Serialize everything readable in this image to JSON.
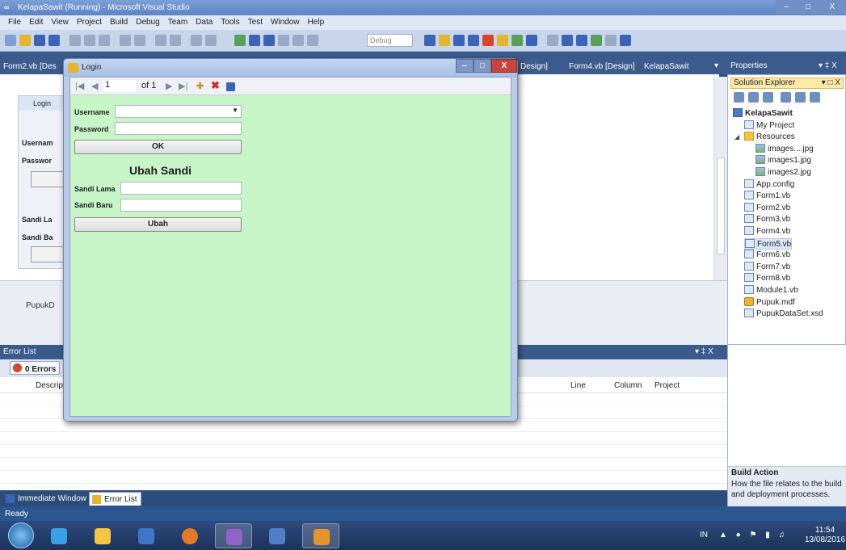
{
  "window": {
    "title": "KelapaSawit (Running) - Microsoft Visual Studio",
    "minimize": "‒",
    "restore": "□",
    "close": "X"
  },
  "menu": [
    "File",
    "Edit",
    "View",
    "Project",
    "Build",
    "Debug",
    "Team",
    "Data",
    "Tools",
    "Test",
    "Window",
    "Help"
  ],
  "toolbar": {
    "config": "Debug"
  },
  "doc_tabs": [
    {
      "label": "Form2.vb [Des"
    },
    {
      "label": "Design]"
    },
    {
      "label": "Form4.vb [Design]"
    },
    {
      "label": "KelapaSawit"
    }
  ],
  "background_form": {
    "title": "Login",
    "username": "Usernam",
    "password": "Passwor",
    "sandi_lama": "Sandi La",
    "sandi_baru": "Sandi Ba",
    "tray_item": "PupukD"
  },
  "error_list": {
    "title": "Error List",
    "errors_button": "0 Errors",
    "columns": [
      "Descrip",
      "Line",
      "Column",
      "Project"
    ]
  },
  "bottom_tabs": [
    {
      "label": "Immediate Window"
    },
    {
      "label": "Error List"
    }
  ],
  "status": "Ready",
  "properties": {
    "title": "Properties",
    "pin": "▾   1 X"
  },
  "solution_explorer": {
    "title": "Solution Explorer",
    "items": [
      {
        "label": "KelapaSawit",
        "indent": 0,
        "type": "proj",
        "bold": true
      },
      {
        "label": "My Project",
        "indent": 1,
        "type": "cfg"
      },
      {
        "label": "Resources",
        "indent": 1,
        "type": "folder",
        "expander": "◢"
      },
      {
        "label": "images....jpg",
        "indent": 2,
        "type": "img"
      },
      {
        "label": "images1.jpg",
        "indent": 2,
        "type": "img"
      },
      {
        "label": "images2.jpg",
        "indent": 2,
        "type": "img"
      },
      {
        "label": "App.config",
        "indent": 1,
        "type": "cfg"
      },
      {
        "label": "Form1.vb",
        "indent": 1,
        "type": "vb"
      },
      {
        "label": "Form2.vb",
        "indent": 1,
        "type": "vb"
      },
      {
        "label": "Form3.vb",
        "indent": 1,
        "type": "vb"
      },
      {
        "label": "Form4.vb",
        "indent": 1,
        "type": "vb"
      },
      {
        "label": "Form5.vb",
        "indent": 1,
        "type": "vb",
        "selected": true
      },
      {
        "label": "Form6.vb",
        "indent": 1,
        "type": "vb"
      },
      {
        "label": "Form7.vb",
        "indent": 1,
        "type": "vb"
      },
      {
        "label": "Form8.vb",
        "indent": 1,
        "type": "vb"
      },
      {
        "label": "Module1.vb",
        "indent": 1,
        "type": "vb"
      },
      {
        "label": "Pupuk.mdf",
        "indent": 1,
        "type": "db"
      },
      {
        "label": "PupukDataSet.xsd",
        "indent": 1,
        "type": "cfg"
      }
    ]
  },
  "build_action": {
    "title": "Build Action",
    "description": "How the file relates to the build and deployment processes."
  },
  "login_dialog": {
    "title": "Login",
    "navigator": {
      "first": "|◀",
      "prev": "◀",
      "position": "1",
      "count": "of 1",
      "next": "▶",
      "last": "▶|",
      "add": "✚",
      "delete": "✖"
    },
    "username_label": "Username",
    "username_value": "",
    "password_label": "Password",
    "password_value": "",
    "ok_button": "OK",
    "section_title": "Ubah Sandi",
    "sandi_lama_label": "Sandi Lama",
    "sandi_baru_label": "Sandi Baru",
    "ubah_button": "Ubah",
    "background_color": "#c8f5c8"
  },
  "taskbar": {
    "language": "IN",
    "time": "11:54",
    "date": "13/08/2016"
  }
}
